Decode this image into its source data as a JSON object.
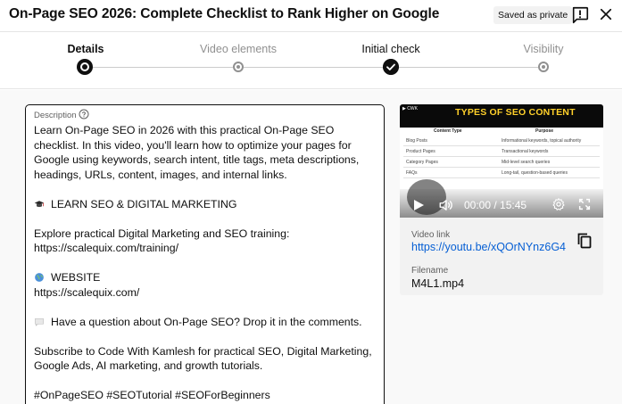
{
  "header": {
    "title": "On-Page SEO 2026: Complete Checklist to Rank Higher on Google",
    "saved_badge": "Saved as private",
    "feedback_icon": "feedback-icon",
    "close_icon": "close-icon"
  },
  "stepper": {
    "steps": [
      {
        "label": "Details",
        "state": "current"
      },
      {
        "label": "Video elements",
        "state": "pending"
      },
      {
        "label": "Initial check",
        "state": "done"
      },
      {
        "label": "Visibility",
        "state": "pending"
      }
    ]
  },
  "description": {
    "label": "Description",
    "help_icon": "help-circle-icon",
    "paragraph1": "Learn On-Page SEO in 2026 with this practical On-Page SEO checklist. In this video, you'll learn how to optimize your pages for Google using keywords, search intent, title tags, meta descriptions, headings, URLs, content, images, and internal links.",
    "learn_heading": "LEARN SEO & DIGITAL MARKETING",
    "learn_text": "Explore practical Digital Marketing and SEO training:",
    "learn_url": "https://scalequix.com/training/",
    "website_heading": "WEBSITE",
    "website_url": "https://scalequix.com/",
    "question": "Have a question about On-Page SEO? Drop it in the comments.",
    "subscribe": "Subscribe to Code With Kamlesh for practical SEO, Digital Marketing, Google Ads, AI marketing, and growth tutorials.",
    "hashtags": "#OnPageSEO #SEOTutorial #SEOForBeginners"
  },
  "video": {
    "thumb_title": "TYPES OF SEO CONTENT",
    "col_left": "Content Type",
    "col_right": "Purpose",
    "rows": [
      {
        "type": "Blog Posts",
        "purpose": "Informational keywords, topical authority"
      },
      {
        "type": "Product Pages",
        "purpose": "Transactional keywords"
      },
      {
        "type": "Category Pages",
        "purpose": "Mid-level search queries"
      },
      {
        "type": "FAQs",
        "purpose": "Long-tail, question-based queries"
      }
    ],
    "time": "00:00 / 15:45",
    "link_label": "Video link",
    "link_url": "https://youtu.be/xQOrNYnz6G4",
    "file_label": "Filename",
    "file_name": "M4L1.mp4"
  },
  "colors": {
    "accent_link": "#065fd4",
    "text_primary": "#0f0f0f",
    "text_secondary": "#606060",
    "thumb_title": "#ffd02a"
  }
}
